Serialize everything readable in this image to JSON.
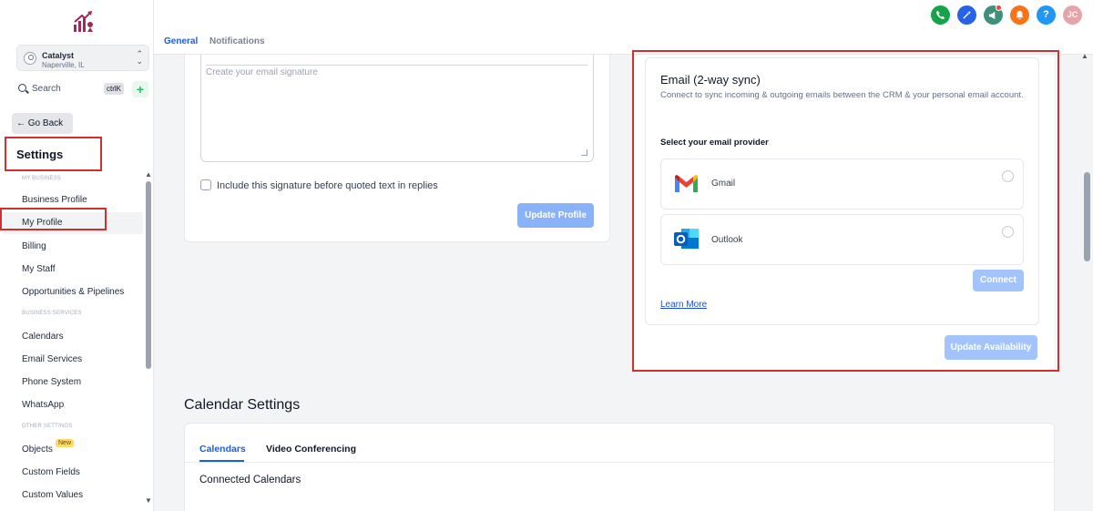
{
  "sidebar": {
    "location": {
      "name": "Catalyst",
      "city": "Naperville, IL"
    },
    "search": {
      "label": "Search",
      "shortcut": "ctrlK"
    },
    "go_back": "← Go Back",
    "settings_title": "Settings",
    "sections": {
      "my_business": "MY BUSINESS",
      "business_services": "BUSINESS SERVICES",
      "other_settings": "OTHER SETTINGS"
    },
    "items": {
      "business_profile": "Business Profile",
      "my_profile": "My Profile",
      "billing": "Billing",
      "my_staff": "My Staff",
      "opportunities": "Opportunities & Pipelines",
      "calendars": "Calendars",
      "email_services": "Email Services",
      "phone_system": "Phone System",
      "whatsapp": "WhatsApp",
      "objects": "Objects",
      "custom_fields": "Custom Fields",
      "custom_values": "Custom Values"
    },
    "new_badge": "New"
  },
  "topbar": {
    "tabs": {
      "general": "General",
      "notifications": "Notifications"
    },
    "avatar_initials": "JC",
    "help": "?"
  },
  "signature": {
    "placeholder": "Create your email signature",
    "checkbox_label": "Include this signature before quoted text in replies",
    "update_button": "Update Profile"
  },
  "email_sync": {
    "title": "Email (2-way sync)",
    "description": "Connect to sync incoming & outgoing emails between the CRM & your personal email account.",
    "provider_label": "Select your email provider",
    "providers": {
      "gmail": "Gmail",
      "outlook": "Outlook"
    },
    "connect_button": "Connect",
    "learn_more": "Learn More",
    "update_availability": "Update Availability"
  },
  "calendar_settings": {
    "title": "Calendar Settings",
    "tabs": {
      "calendars": "Calendars",
      "video": "Video Conferencing"
    },
    "connected_title": "Connected Calendars"
  },
  "colors": {
    "accent": "#155eef",
    "highlight_box": "#d32f2f",
    "button_disabled": "#89b3f8"
  }
}
